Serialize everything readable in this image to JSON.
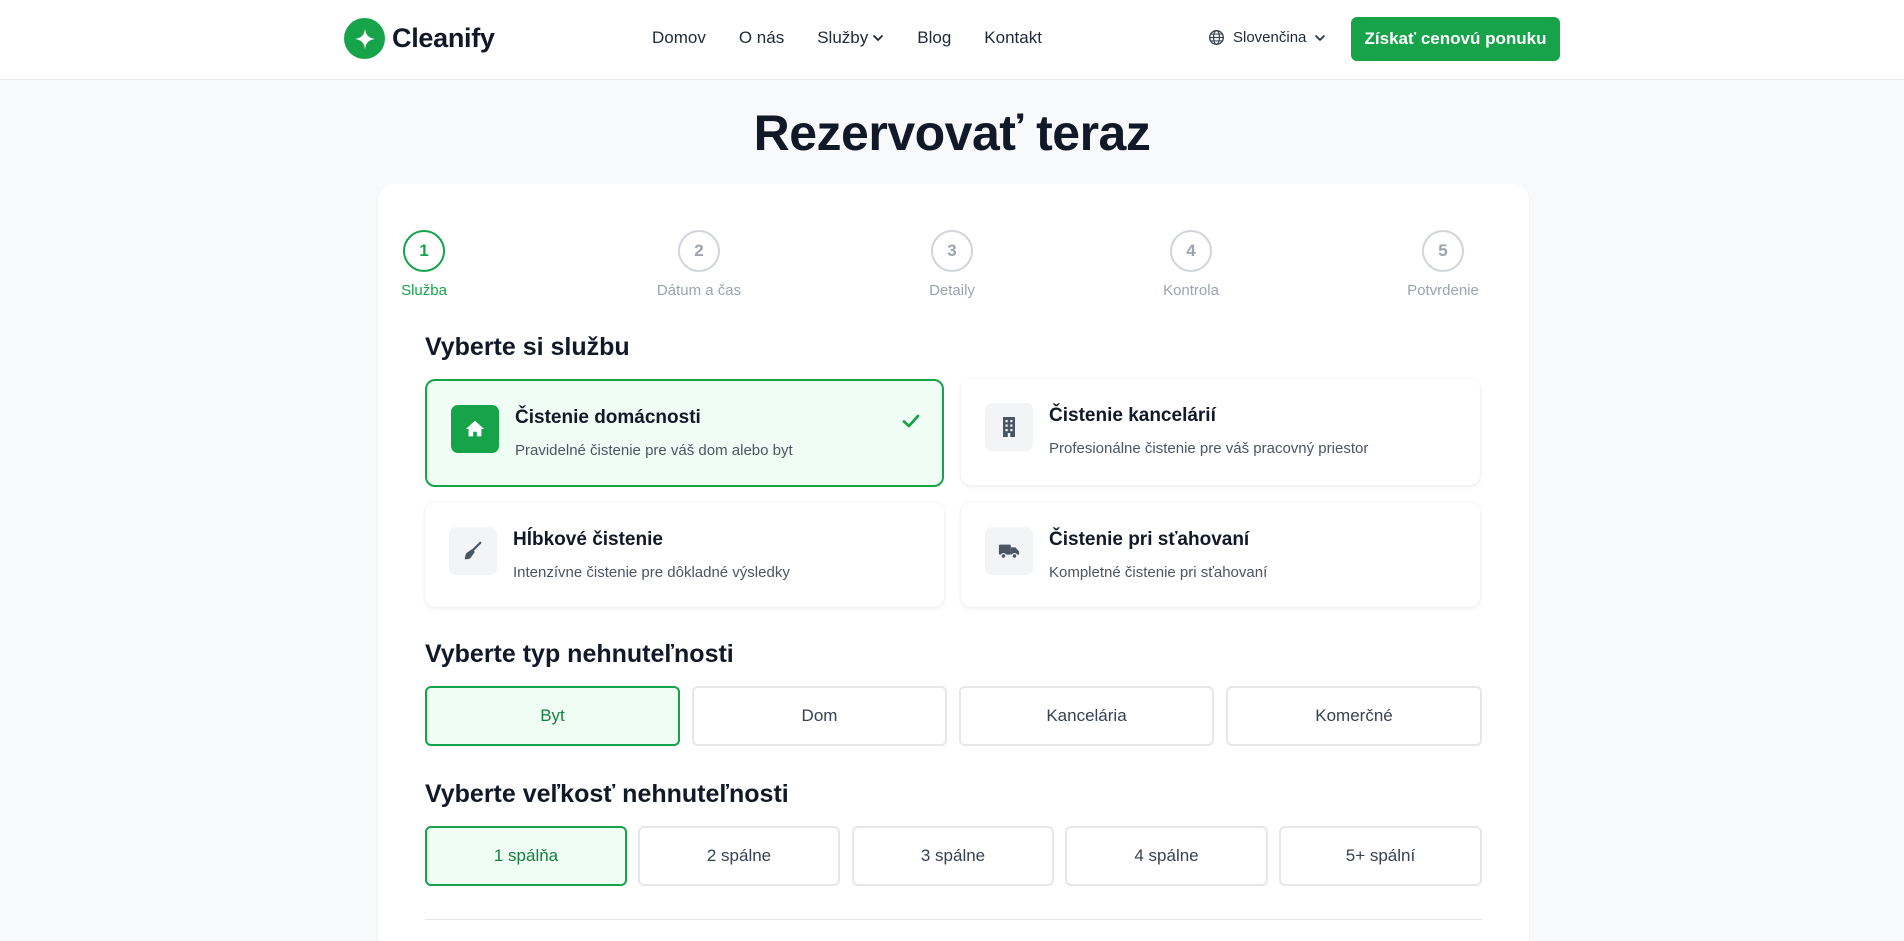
{
  "header": {
    "brand": "Cleanify",
    "nav": [
      "Domov",
      "O nás",
      "Služby",
      "Blog",
      "Kontakt"
    ],
    "language": "Slovenčina",
    "cta_label": "Získať cenovú ponuku"
  },
  "page_title": "Rezervovať teraz",
  "steps": [
    {
      "number": "1",
      "label": "Služba"
    },
    {
      "number": "2",
      "label": "Dátum a čas"
    },
    {
      "number": "3",
      "label": "Detaily"
    },
    {
      "number": "4",
      "label": "Kontrola"
    },
    {
      "number": "5",
      "label": "Potvrdenie"
    }
  ],
  "active_step": 1,
  "service_section": {
    "title": "Vyberte si službu",
    "services": [
      {
        "title": "Čistenie domácnosti",
        "description": "Pravidelné čistenie pre váš dom alebo byt",
        "icon": "home-icon",
        "selected": true
      },
      {
        "title": "Čistenie kancelárií",
        "description": "Profesionálne čistenie pre váš pracovný priestor",
        "icon": "building-icon",
        "selected": false
      },
      {
        "title": "Hĺbkové čistenie",
        "description": "Intenzívne čistenie pre dôkladné výsledky",
        "icon": "broom-icon",
        "selected": false
      },
      {
        "title": "Čistenie pri sťahovaní",
        "description": "Kompletné čistenie pri sťahovaní",
        "icon": "truck-icon",
        "selected": false
      }
    ]
  },
  "property_type_section": {
    "title": "Vyberte typ nehnuteľnosti",
    "options": [
      "Byt",
      "Dom",
      "Kancelária",
      "Komerčné"
    ],
    "selected": "Byt"
  },
  "property_size_section": {
    "title": "Vyberte veľkosť nehnuteľnosti",
    "options": [
      "1 spálňa",
      "2 spálne",
      "3 spálne",
      "4 spálne",
      "5+ spální"
    ],
    "selected": "1 spálňa"
  },
  "colors": {
    "primary": "#16a34a",
    "primary_light": "#f0fdf4",
    "text": "#111827",
    "muted": "#9ca3af"
  }
}
